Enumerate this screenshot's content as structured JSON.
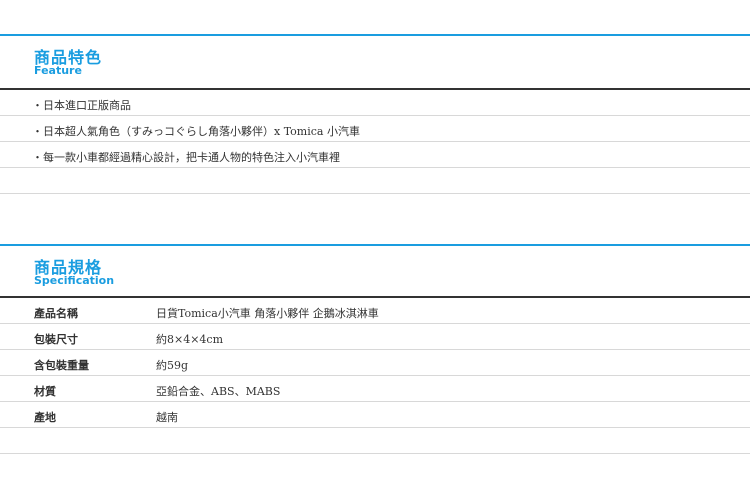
{
  "feature": {
    "title": "商品特色",
    "subtitle": "Feature",
    "items": [
      "・日本進口正版商品",
      "・日本超人氣角色（すみっコぐらし角落小夥伴）x Tomica 小汽車",
      "・每一款小車都經過精心設計，把卡通人物的特色注入小汽車裡"
    ]
  },
  "spec": {
    "title": "商品規格",
    "subtitle": "Specification",
    "rows": [
      {
        "label": "產品名稱",
        "value": "日貨Tomica小汽車 角落小夥伴 企鵝冰淇淋車"
      },
      {
        "label": "包裝尺寸",
        "value": "約8×4×4cm"
      },
      {
        "label": "含包裝重量",
        "value": "約59g"
      },
      {
        "label": "材質",
        "value": "亞鉛合金、ABS、MABS"
      },
      {
        "label": "產地",
        "value": "越南"
      }
    ]
  },
  "colors": {
    "accent": "#1a9de0",
    "text": "#333333",
    "rule": "#d8d8d8"
  }
}
